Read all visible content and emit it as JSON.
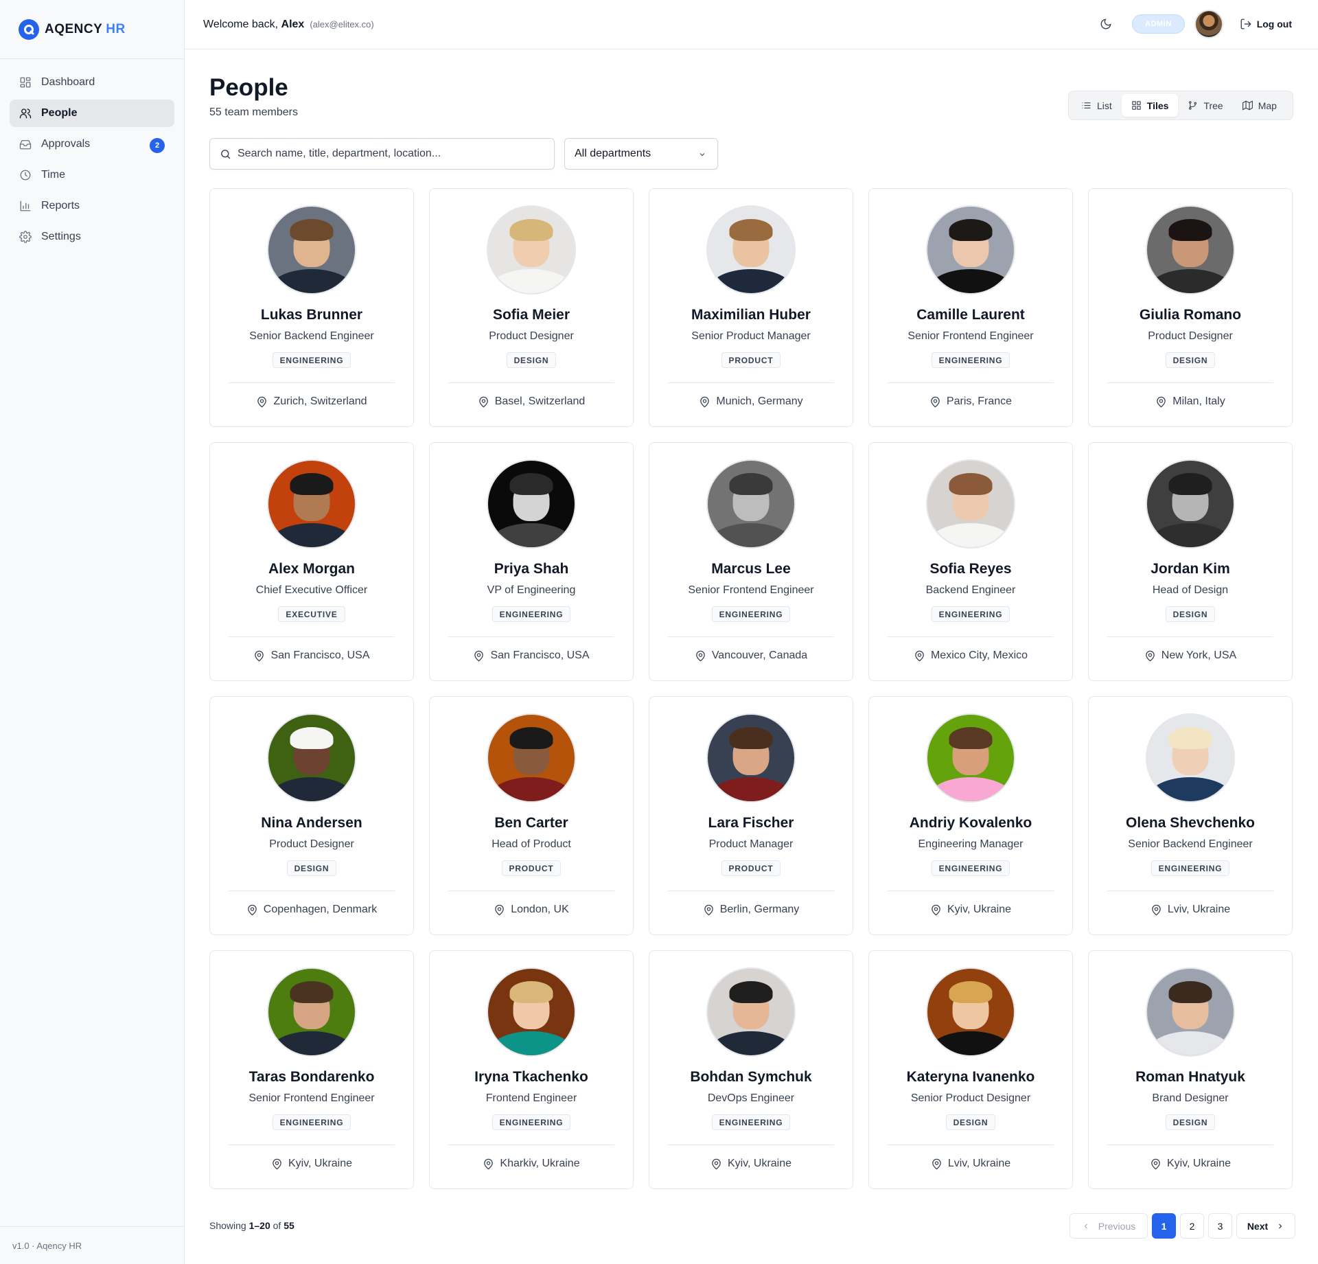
{
  "brand": {
    "name": "AQENCY",
    "accent": "HR",
    "color": "#2563eb"
  },
  "sidebar": {
    "items": [
      {
        "label": "Dashboard",
        "icon": "dashboard-icon",
        "active": false
      },
      {
        "label": "People",
        "icon": "people-icon",
        "active": true
      },
      {
        "label": "Approvals",
        "icon": "inbox-icon",
        "active": false,
        "badge": "2"
      },
      {
        "label": "Time",
        "icon": "clock-icon",
        "active": false
      },
      {
        "label": "Reports",
        "icon": "bar-chart-icon",
        "active": false
      },
      {
        "label": "Settings",
        "icon": "gear-icon",
        "active": false
      }
    ],
    "footer": "v1.0 · Aqency HR"
  },
  "header": {
    "welcome_prefix": "Welcome back,",
    "user_name": "Alex",
    "email": "(alex@elitex.co)",
    "role_badge": "ADMIN",
    "logout_label": "Log out"
  },
  "page": {
    "title": "People",
    "subtitle": "55 team members"
  },
  "view_toggle": [
    {
      "label": "List",
      "icon": "list-icon",
      "active": false
    },
    {
      "label": "Tiles",
      "icon": "grid-icon",
      "active": true
    },
    {
      "label": "Tree",
      "icon": "tree-icon",
      "active": false
    },
    {
      "label": "Map",
      "icon": "map-icon",
      "active": false
    }
  ],
  "filters": {
    "search_placeholder": "Search name, title, department, location...",
    "search_value": "",
    "department_selected": "All departments"
  },
  "people": [
    {
      "name": "Lukas Brunner",
      "title": "Senior Backend Engineer",
      "department": "ENGINEERING",
      "location": "Zurich, Switzerland",
      "skin": "#e0b48f",
      "hair": "#6b4a2e",
      "shirt": "#1f2937",
      "bg": "#6b7280"
    },
    {
      "name": "Sofia Meier",
      "title": "Product Designer",
      "department": "DESIGN",
      "location": "Basel, Switzerland",
      "skin": "#f1cdb0",
      "hair": "#d6b679",
      "shirt": "#f5f5f4",
      "bg": "#e7e5e4"
    },
    {
      "name": "Maximilian Huber",
      "title": "Senior Product Manager",
      "department": "PRODUCT",
      "location": "Munich, Germany",
      "skin": "#eac3a3",
      "hair": "#9a6b3f",
      "shirt": "#1e293b",
      "bg": "#e5e7eb"
    },
    {
      "name": "Camille Laurent",
      "title": "Senior Frontend Engineer",
      "department": "ENGINEERING",
      "location": "Paris, France",
      "skin": "#ecc7ad",
      "hair": "#1c1917",
      "shirt": "#111111",
      "bg": "#9ca3af"
    },
    {
      "name": "Giulia Romano",
      "title": "Product Designer",
      "department": "DESIGN",
      "location": "Milan, Italy",
      "skin": "#c99877",
      "hair": "#1c1412",
      "shirt": "#2b2b2b",
      "bg": "#6b6b6b"
    },
    {
      "name": "Alex Morgan",
      "title": "Chief Executive Officer",
      "department": "EXECUTIVE",
      "location": "San Francisco, USA",
      "skin": "#b07a52",
      "hair": "#1a1a1a",
      "shirt": "#1f2937",
      "bg": "#c2410c"
    },
    {
      "name": "Priya Shah",
      "title": "VP of Engineering",
      "department": "ENGINEERING",
      "location": "San Francisco, USA",
      "skin": "#d4d4d4",
      "hair": "#2a2a2a",
      "shirt": "#404040",
      "bg": "#0a0a0a"
    },
    {
      "name": "Marcus Lee",
      "title": "Senior Frontend Engineer",
      "department": "ENGINEERING",
      "location": "Vancouver, Canada",
      "skin": "#bdbdbd",
      "hair": "#3a3a3a",
      "shirt": "#525252",
      "bg": "#737373"
    },
    {
      "name": "Sofia Reyes",
      "title": "Backend Engineer",
      "department": "ENGINEERING",
      "location": "Mexico City, Mexico",
      "skin": "#eccab0",
      "hair": "#8a5a3a",
      "shirt": "#f5f5f4",
      "bg": "#d6d3d1"
    },
    {
      "name": "Jordan Kim",
      "title": "Head of Design",
      "department": "DESIGN",
      "location": "New York, USA",
      "skin": "#b5b5b5",
      "hair": "#1f1f1f",
      "shirt": "#2e2e2e",
      "bg": "#3f3f3f"
    },
    {
      "name": "Nina Andersen",
      "title": "Product Designer",
      "department": "DESIGN",
      "location": "Copenhagen, Denmark",
      "skin": "#6b4330",
      "hair": "#f5f5f4",
      "shirt": "#1f2937",
      "bg": "#3f6212"
    },
    {
      "name": "Ben Carter",
      "title": "Head of Product",
      "department": "PRODUCT",
      "location": "London, UK",
      "skin": "#8a5a3c",
      "hair": "#1a1a1a",
      "shirt": "#7f1d1d",
      "bg": "#b45309"
    },
    {
      "name": "Lara Fischer",
      "title": "Product Manager",
      "department": "PRODUCT",
      "location": "Berlin, Germany",
      "skin": "#d9a786",
      "hair": "#4a2e1e",
      "shirt": "#7f1d1d",
      "bg": "#374151"
    },
    {
      "name": "Andriy Kovalenko",
      "title": "Engineering Manager",
      "department": "ENGINEERING",
      "location": "Kyiv, Ukraine",
      "skin": "#d8a07a",
      "hair": "#5a3a24",
      "shirt": "#f9a8d4",
      "bg": "#65a30d"
    },
    {
      "name": "Olena Shevchenko",
      "title": "Senior Backend Engineer",
      "department": "ENGINEERING",
      "location": "Lviv, Ukraine",
      "skin": "#efcfb6",
      "hair": "#f3e5c4",
      "shirt": "#1e3a5f",
      "bg": "#e5e7eb"
    },
    {
      "name": "Taras Bondarenko",
      "title": "Senior Frontend Engineer",
      "department": "ENGINEERING",
      "location": "Kyiv, Ukraine",
      "skin": "#d6a584",
      "hair": "#4b3322",
      "shirt": "#1f2937",
      "bg": "#4d7c0f"
    },
    {
      "name": "Iryna Tkachenko",
      "title": "Frontend Engineer",
      "department": "ENGINEERING",
      "location": "Kharkiv, Ukraine",
      "skin": "#f0c9ab",
      "hair": "#d9b77a",
      "shirt": "#0d9488",
      "bg": "#78350f"
    },
    {
      "name": "Bohdan Symchuk",
      "title": "DevOps Engineer",
      "department": "ENGINEERING",
      "location": "Kyiv, Ukraine",
      "skin": "#e5b797",
      "hair": "#1f1f1f",
      "shirt": "#1f2937",
      "bg": "#d6d3d1"
    },
    {
      "name": "Kateryna Ivanenko",
      "title": "Senior Product Designer",
      "department": "DESIGN",
      "location": "Lviv, Ukraine",
      "skin": "#efc6a2",
      "hair": "#d8a652",
      "shirt": "#111111",
      "bg": "#92400e"
    },
    {
      "name": "Roman Hnatyuk",
      "title": "Brand Designer",
      "department": "DESIGN",
      "location": "Kyiv, Ukraine",
      "skin": "#e6bd9f",
      "hair": "#3b2a1e",
      "shirt": "#e5e7eb",
      "bg": "#9ca3af"
    }
  ],
  "pagination": {
    "showing_prefix": "Showing",
    "range": "1–20",
    "of_label": "of",
    "total": "55",
    "previous_label": "Previous",
    "next_label": "Next",
    "pages": [
      "1",
      "2",
      "3"
    ],
    "current": "1"
  }
}
